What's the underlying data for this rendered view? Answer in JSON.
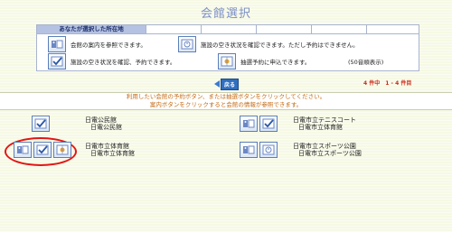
{
  "page_title": "会館選択",
  "location": {
    "label": "あなたが選択した所在地"
  },
  "legend": [
    {
      "icon": "info-icon",
      "text": "会館の案内を参照できます。"
    },
    {
      "icon": "vacancy-icon",
      "text": "施設の空き状況を確認できます。ただし予約はできません。"
    },
    {
      "icon": "reserve-check-icon",
      "text": "施設の空き状況を確認、予約できます。"
    },
    {
      "icon": "lottery-icon",
      "text": "抽選予約に申込できます。"
    }
  ],
  "sort_note": "(50音順表示)",
  "result_count": "4 件中　1 - 4 件目",
  "back_button": "戻る",
  "notice": {
    "line1": "利用したい会館の予約ボタン、または抽選ボタンをクリックしてください。",
    "line2": "案内ボタンをクリックすると会館の情報が参照できます。"
  },
  "facilities": [
    {
      "name": "日電公民館",
      "sub": "日電公民館"
    },
    {
      "name": "日電市立テニスコート",
      "sub": "日電市立体育館"
    },
    {
      "name": "日電市立体育館",
      "sub": "日電市立体育館"
    },
    {
      "name": "日電市立スポーツ公園",
      "sub": "日電市立スポーツ公園"
    }
  ],
  "colors": {
    "accent": "#2f6fc0",
    "notice_text": "#c46a12",
    "highlight": "#e21515",
    "title": "#7b8fc6"
  }
}
